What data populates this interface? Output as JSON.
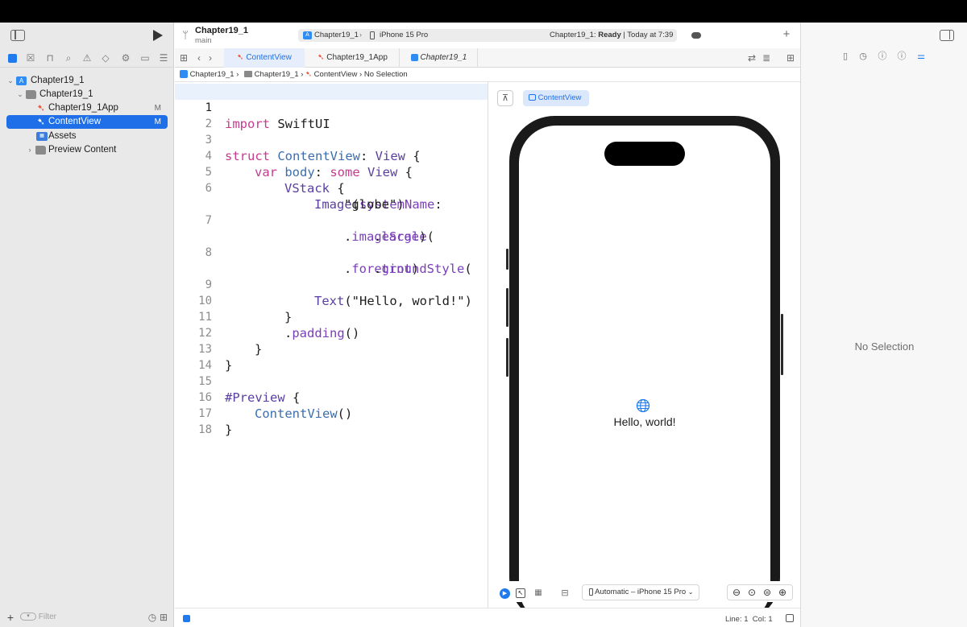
{
  "project": {
    "name": "Chapter19_1",
    "branch": "main"
  },
  "scheme": {
    "target": "Chapter19_1",
    "device": "iPhone 15 Pro",
    "status_prefix": "Chapter19_1: ",
    "status_ready": "Ready",
    "status_suffix": " | Today at 7:39"
  },
  "navigator": {
    "items": [
      {
        "label": "Chapter19_1"
      },
      {
        "label": "Chapter19_1"
      },
      {
        "label": "Chapter19_1App",
        "badge": "M"
      },
      {
        "label": "ContentView",
        "badge": "M"
      },
      {
        "label": "Assets"
      },
      {
        "label": "Preview Content"
      }
    ],
    "filter_placeholder": "Filter"
  },
  "editor_tabs": [
    {
      "label": "ContentView"
    },
    {
      "label": "Chapter19_1App"
    },
    {
      "label": "Chapter19_1"
    }
  ],
  "jumpbar": {
    "crumb1": "Chapter19_1",
    "crumb2": "Chapter19_1",
    "crumb3": "ContentView",
    "crumb4": "No Selection"
  },
  "code": {
    "lines": [
      "1",
      "2",
      "3",
      "4",
      "5",
      "6",
      "",
      "7",
      "",
      "8",
      "",
      "9",
      "10",
      "11",
      "12",
      "13",
      "14",
      "15",
      "16",
      "17",
      "18"
    ],
    "l1_kw": "import",
    "l1_rest": " SwiftUI",
    "l3_kw": "struct",
    "l3_name": " ContentView",
    "l3_rest": ": ",
    "l3_ty": "View",
    "l3_end": " {",
    "l4_kw": "var",
    "l4_name": " body",
    "l4_rest": ": ",
    "l4_kw2": "some",
    "l4_ty": " View",
    "l4_end": " {",
    "l5_ty": "VStack",
    "l5_end": " {",
    "l6_ty": "Image",
    "l6_open": "(",
    "l6_arg": "systemName",
    "l6_colon": ":",
    "l6b_str": "\"globe\")",
    "l7_dot": ".",
    "l7_fn": "imageScale",
    "l7_open": "(",
    "l7b_dot": ".",
    "l7b_val": "large",
    "l7b_close": ")",
    "l8_dot": ".",
    "l8_fn": "foregroundStyle",
    "l8_open": "(",
    "l8b_dot": ".",
    "l8b_val": "tint",
    "l8b_close": ")",
    "l9_ty": "Text",
    "l9_rest": "(\"Hello, world!\")",
    "l10": "}",
    "l11_dot": ".",
    "l11_fn": "padding",
    "l11_rest": "()",
    "l12": "}",
    "l13": "}",
    "l15_kw": "#Preview",
    "l15_end": " {",
    "l16_ty": "ContentView",
    "l16_rest": "()",
    "l17": "}"
  },
  "canvas": {
    "preview_chip": "ContentView",
    "hello_text": "Hello, world!",
    "device_picker": "Automatic – iPhone 15 Pro"
  },
  "inspector": {
    "empty_text": "No Selection"
  },
  "status": {
    "line_col": "Line: 1  Col: 1"
  }
}
